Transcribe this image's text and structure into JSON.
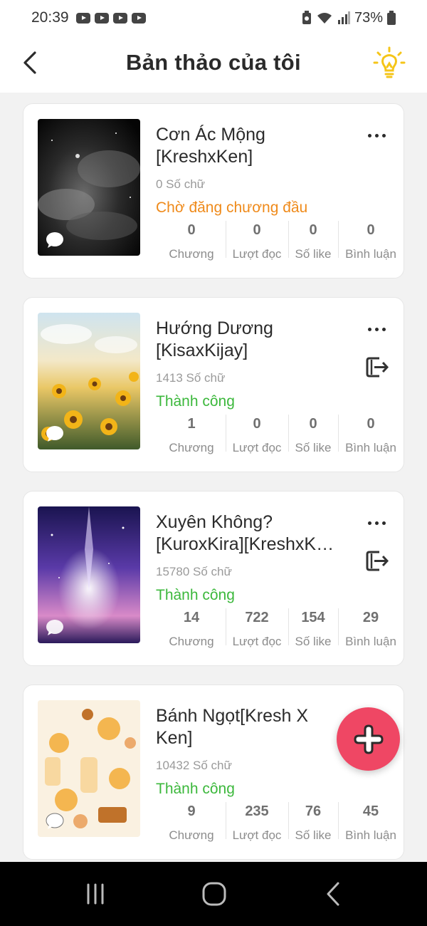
{
  "status_bar": {
    "time": "20:39",
    "battery": "73%"
  },
  "header": {
    "title": "Bản thảo của tôi"
  },
  "books": [
    {
      "title_line1": "Cơn Ác Mộng",
      "title_line2": "[KreshxKen]",
      "word_count": "0 Số chữ",
      "status": "Chờ đăng chương đầu",
      "status_type": "wait",
      "stats": {
        "chapters": "0",
        "reads": "0",
        "likes": "0",
        "comments": "0"
      }
    },
    {
      "title_line1": "Hướng Dương",
      "title_line2": "[KisaxKijay]",
      "word_count": "1413 Số chữ",
      "status": "Thành công",
      "status_type": "ok",
      "stats": {
        "chapters": "1",
        "reads": "0",
        "likes": "0",
        "comments": "0"
      }
    },
    {
      "title_line1": "Xuyên Không?",
      "title_line2": "[KuroxKira][KreshxK…",
      "word_count": "15780 Số chữ",
      "status": "Thành công",
      "status_type": "ok",
      "stats": {
        "chapters": "14",
        "reads": "722",
        "likes": "154",
        "comments": "29"
      }
    },
    {
      "title_line1": "Bánh Ngọt[Kresh X",
      "title_line2": "Ken]",
      "word_count": "10432 Số chữ",
      "status": "Thành công",
      "status_type": "ok",
      "stats": {
        "chapters": "9",
        "reads": "235",
        "likes": "76",
        "comments": "45"
      }
    }
  ],
  "stat_labels": {
    "chapters": "Chương",
    "reads": "Lượt đọc",
    "likes": "Số like",
    "comments": "Bình luận"
  },
  "colors": {
    "status_wait": "#ef8a1a",
    "status_ok": "#3cb83c",
    "fab": "#ef4764",
    "idea_icon": "#f5c518"
  },
  "icons": {
    "back": "chevron-left-icon",
    "idea": "lightbulb-icon",
    "more": "more-horizontal-icon",
    "export": "export-icon",
    "add": "plus-icon",
    "comment": "chat-bubble-icon"
  }
}
